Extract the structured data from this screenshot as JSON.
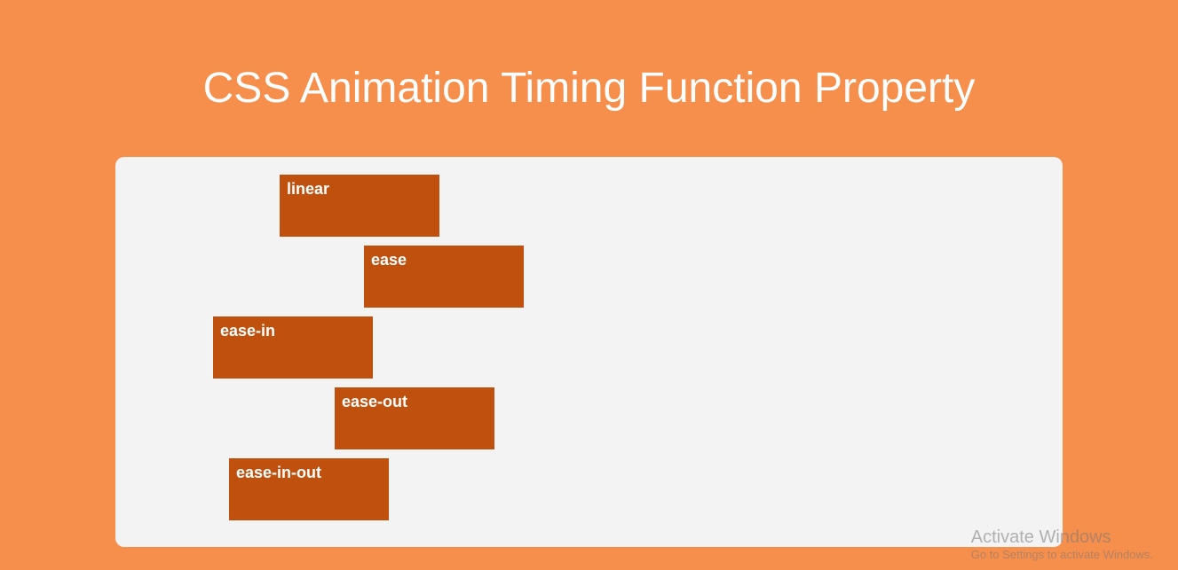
{
  "title": "CSS Animation Timing Function Property",
  "boxes": {
    "linear": "linear",
    "ease": "ease",
    "ease_in": "ease-in",
    "ease_out": "ease-out",
    "ease_in_out": "ease-in-out"
  },
  "watermark": {
    "title": "Activate Windows",
    "sub": "Go to Settings to activate Windows."
  }
}
